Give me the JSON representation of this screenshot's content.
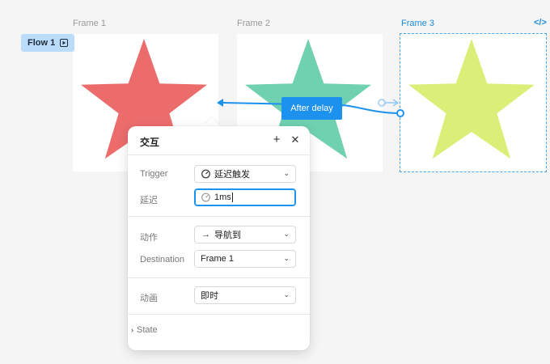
{
  "frames": [
    {
      "label": "Frame 1",
      "star_color": "#ec6c6c"
    },
    {
      "label": "Frame 2",
      "star_color": "#6fd1b0"
    },
    {
      "label": "Frame 3",
      "star_color": "#dbef78"
    }
  ],
  "flow": {
    "label": "Flow 1",
    "icon": "play-frame-icon"
  },
  "frame3_code_icon": "</>",
  "connector": {
    "label": "After delay",
    "color": "#1d91ee"
  },
  "panel": {
    "title": "交互",
    "add_icon": "+",
    "close_icon": "✕",
    "trigger": {
      "label": "Trigger",
      "value": "延迟触发"
    },
    "delay": {
      "label": "延迟",
      "value": "1ms"
    },
    "action": {
      "label": "动作",
      "value": "导航到"
    },
    "destination": {
      "label": "Destination",
      "value": "Frame 1"
    },
    "animation": {
      "label": "动画",
      "value": "即时"
    },
    "state": {
      "label": "State"
    }
  }
}
